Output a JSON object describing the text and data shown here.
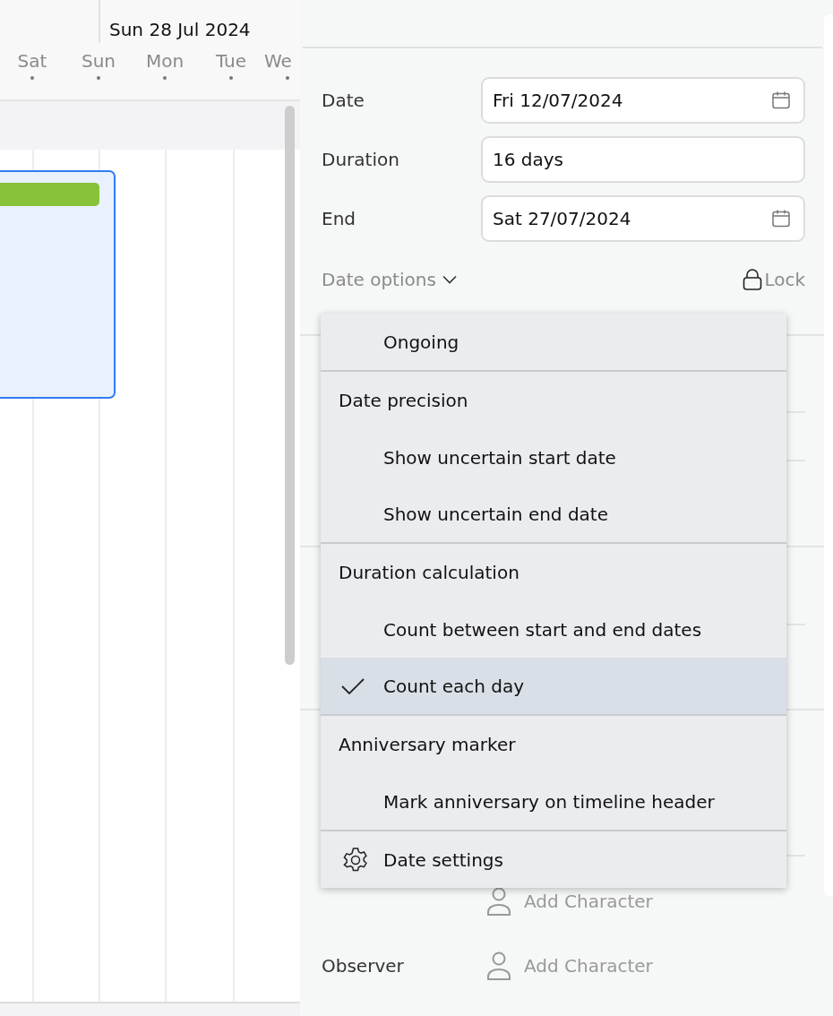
{
  "timeline": {
    "header_date": "Sun 28 Jul 2024",
    "days": [
      "Sat",
      "Sun",
      "Mon",
      "Tue",
      "We"
    ]
  },
  "details": {
    "fields": [
      {
        "label": "Date",
        "value": "Fri 12/07/2024",
        "kind": "date"
      },
      {
        "label": "Duration",
        "value": "16 days",
        "kind": "text"
      },
      {
        "label": "End",
        "value": "Sat 27/07/2024",
        "kind": "date"
      }
    ],
    "date_options": "Date options",
    "lock": "Lock",
    "character_rows": [
      {
        "action": "Add Character"
      },
      {
        "label": "Observer",
        "action": "Add Character"
      }
    ]
  },
  "menu": {
    "groups": [
      {
        "items": [
          {
            "kind": "option",
            "label": "Ongoing",
            "checked": false
          }
        ]
      },
      {
        "items": [
          {
            "kind": "header",
            "label": "Date precision"
          },
          {
            "kind": "option",
            "label": "Show uncertain start date",
            "checked": false
          },
          {
            "kind": "option",
            "label": "Show uncertain end date",
            "checked": false
          }
        ]
      },
      {
        "items": [
          {
            "kind": "header",
            "label": "Duration calculation"
          },
          {
            "kind": "option",
            "label": "Count between start and end dates",
            "checked": false
          },
          {
            "kind": "option",
            "label": "Count each day",
            "checked": true
          }
        ]
      },
      {
        "items": [
          {
            "kind": "header",
            "label": "Anniversary marker"
          },
          {
            "kind": "option",
            "label": "Mark anniversary on timeline header",
            "checked": false
          }
        ]
      },
      {
        "items": [
          {
            "kind": "action",
            "label": "Date settings"
          }
        ]
      }
    ]
  }
}
